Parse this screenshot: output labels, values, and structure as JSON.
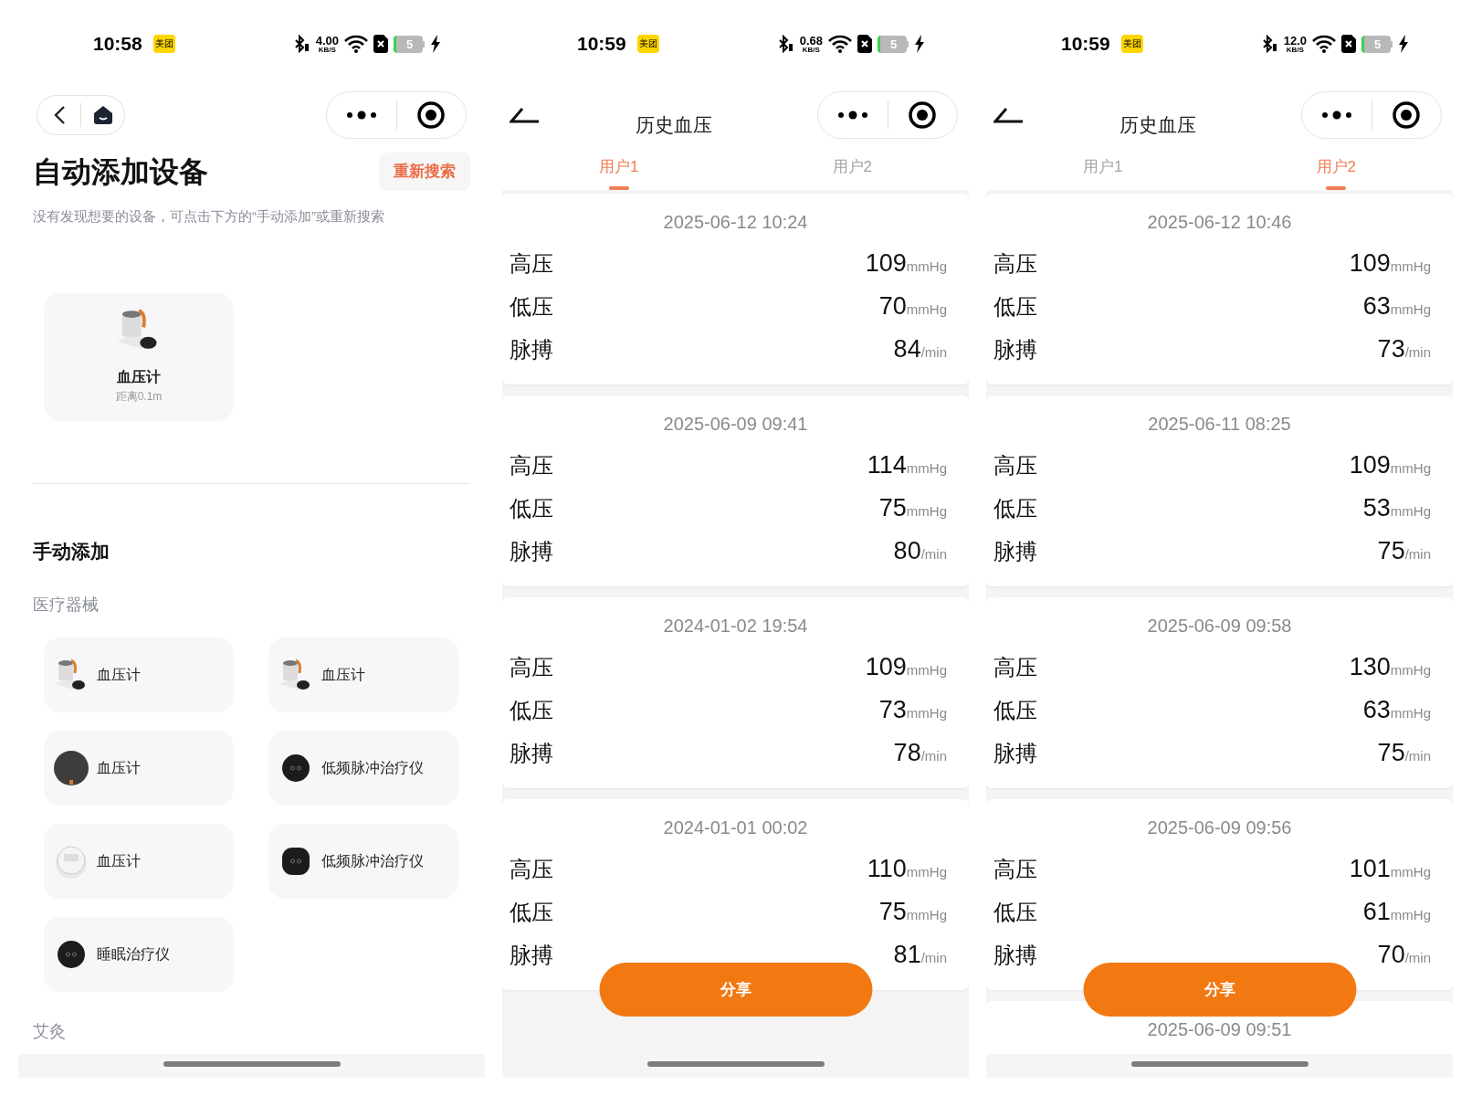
{
  "screens": [
    {
      "kind": "add_device",
      "status_bar": {
        "time": "10:58",
        "app_badge": "美团",
        "net_speed": "4.00",
        "net_unit": "KB/S",
        "battery": "5"
      },
      "title": "自动添加设备",
      "research_button": "重新搜索",
      "hint": "没有发现想要的设备，可点击下方的“手动添加”或重新搜索",
      "found_devices": [
        {
          "name": "血压计",
          "distance": "距离0.1m",
          "kind": "cuff"
        }
      ],
      "manual_title": "手动添加",
      "categories": [
        {
          "name": "医疗器械",
          "devices": [
            {
              "name": "血压计",
              "kind": "cuff"
            },
            {
              "name": "血压计",
              "kind": "cuff"
            },
            {
              "name": "血压计",
              "kind": "dark_disc"
            },
            {
              "name": "低频脉冲治疗仪",
              "kind": "black_round"
            },
            {
              "name": "血压计",
              "kind": "white_disc"
            },
            {
              "name": "低频脉冲治疗仪",
              "kind": "black_square"
            },
            {
              "name": "睡眠治疗仪",
              "kind": "black_round"
            }
          ]
        },
        {
          "name": "艾灸"
        }
      ]
    },
    {
      "kind": "history",
      "status_bar": {
        "time": "10:59",
        "app_badge": "美团",
        "net_speed": "0.68",
        "net_unit": "KB/S",
        "battery": "5"
      },
      "title": "历史血压",
      "tabs": [
        {
          "label": "用户1",
          "selected": true
        },
        {
          "label": "用户2",
          "selected": false
        }
      ],
      "records": [
        {
          "time": "2025-06-12 10:24",
          "rows": [
            {
              "label": "高压",
              "value": "109",
              "unit": "mmHg"
            },
            {
              "label": "低压",
              "value": "70",
              "unit": "mmHg"
            },
            {
              "label": "脉搏",
              "value": "84",
              "unit": "/min"
            }
          ]
        },
        {
          "time": "2025-06-09 09:41",
          "rows": [
            {
              "label": "高压",
              "value": "114",
              "unit": "mmHg"
            },
            {
              "label": "低压",
              "value": "75",
              "unit": "mmHg"
            },
            {
              "label": "脉搏",
              "value": "80",
              "unit": "/min"
            }
          ]
        },
        {
          "time": "2024-01-02 19:54",
          "rows": [
            {
              "label": "高压",
              "value": "109",
              "unit": "mmHg"
            },
            {
              "label": "低压",
              "value": "73",
              "unit": "mmHg"
            },
            {
              "label": "脉搏",
              "value": "78",
              "unit": "/min"
            }
          ]
        },
        {
          "time": "2024-01-01 00:02",
          "rows": [
            {
              "label": "高压",
              "value": "110",
              "unit": "mmHg"
            },
            {
              "label": "低压",
              "value": "75",
              "unit": "mmHg"
            },
            {
              "label": "脉搏",
              "value": "81",
              "unit": "/min"
            }
          ]
        }
      ],
      "share_button": "分享"
    },
    {
      "kind": "history",
      "status_bar": {
        "time": "10:59",
        "app_badge": "美团",
        "net_speed": "12.0",
        "net_unit": "KB/S",
        "battery": "5"
      },
      "title": "历史血压",
      "tabs": [
        {
          "label": "用户1",
          "selected": false
        },
        {
          "label": "用户2",
          "selected": true
        }
      ],
      "records": [
        {
          "time": "2025-06-12 10:46",
          "rows": [
            {
              "label": "高压",
              "value": "109",
              "unit": "mmHg"
            },
            {
              "label": "低压",
              "value": "63",
              "unit": "mmHg"
            },
            {
              "label": "脉搏",
              "value": "73",
              "unit": "/min"
            }
          ]
        },
        {
          "time": "2025-06-11 08:25",
          "rows": [
            {
              "label": "高压",
              "value": "109",
              "unit": "mmHg"
            },
            {
              "label": "低压",
              "value": "53",
              "unit": "mmHg"
            },
            {
              "label": "脉搏",
              "value": "75",
              "unit": "/min"
            }
          ]
        },
        {
          "time": "2025-06-09 09:58",
          "rows": [
            {
              "label": "高压",
              "value": "130",
              "unit": "mmHg"
            },
            {
              "label": "低压",
              "value": "63",
              "unit": "mmHg"
            },
            {
              "label": "脉搏",
              "value": "75",
              "unit": "/min"
            }
          ]
        },
        {
          "time": "2025-06-09 09:56",
          "rows": [
            {
              "label": "高压",
              "value": "101",
              "unit": "mmHg"
            },
            {
              "label": "低压",
              "value": "61",
              "unit": "mmHg"
            },
            {
              "label": "脉搏",
              "value": "70",
              "unit": "/min"
            }
          ]
        },
        {
          "time": "2025-06-09 09:51"
        }
      ],
      "share_button": "分享"
    }
  ]
}
